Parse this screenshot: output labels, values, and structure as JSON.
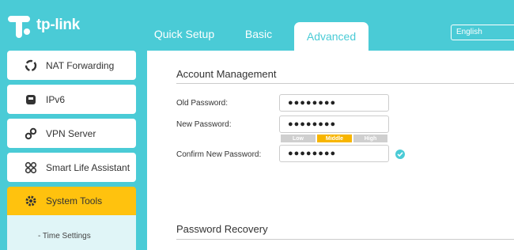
{
  "brand": {
    "logo_text": "tp-link"
  },
  "tabs": [
    {
      "label": "Quick Setup"
    },
    {
      "label": "Basic"
    },
    {
      "label": "Advanced"
    }
  ],
  "language": {
    "selected": "English"
  },
  "sidebar": {
    "items": [
      {
        "label": "NAT Forwarding",
        "icon": "nat-forwarding-icon"
      },
      {
        "label": "IPv6",
        "icon": "ipv6-icon"
      },
      {
        "label": "VPN Server",
        "icon": "vpn-link-icon"
      },
      {
        "label": "Smart Life Assistant",
        "icon": "smart-life-icon"
      },
      {
        "label": "System Tools",
        "icon": "gear-icon"
      }
    ],
    "sub_items": [
      {
        "label": "- Time Settings"
      }
    ]
  },
  "account_management": {
    "title": "Account Management",
    "old_password_label": "Old Password:",
    "old_password_value": "●●●●●●●●",
    "new_password_label": "New Password:",
    "new_password_value": "●●●●●●●●",
    "strength": {
      "low": "Low",
      "middle": "Middle",
      "high": "High",
      "level": "Middle"
    },
    "confirm_password_label": "Confirm New Password:",
    "confirm_password_value": "●●●●●●●●"
  },
  "password_recovery": {
    "title": "Password Recovery"
  },
  "colors": {
    "accent": "#4acbd6",
    "selected": "#ffc20e",
    "strength_mid": "#f7b500"
  }
}
